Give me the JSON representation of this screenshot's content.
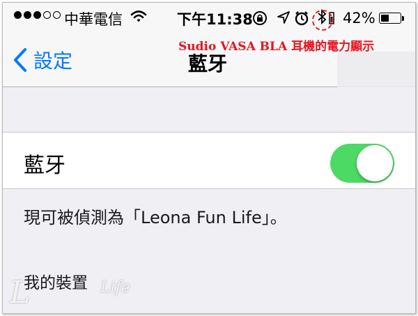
{
  "status_bar": {
    "signal_dots_filled": 3,
    "signal_dots_total": 5,
    "carrier": "中華電信",
    "time": "下午11:38",
    "battery_percent": "42%",
    "battery_level": 0.42,
    "icons": [
      "wifi-icon",
      "rotation-lock-icon",
      "location-icon",
      "alarm-icon",
      "bluetooth-icon",
      "headphone-battery-icon",
      "battery-icon"
    ]
  },
  "annotation": {
    "text": "Sudio VASA BLA 耳機的電力顯示",
    "color": "#e8141e"
  },
  "nav": {
    "back_label": "設定",
    "title": "藍牙"
  },
  "bluetooth_cell": {
    "label": "藍牙",
    "toggle_on": true,
    "toggle_color": "#4cd964"
  },
  "discoverable_note": "現可被偵測為「Leona Fun Life」。",
  "section_header": "我的裝置",
  "watermark": {
    "text": "Life"
  },
  "colors": {
    "accent": "#007aff",
    "background": "#efeff4"
  }
}
